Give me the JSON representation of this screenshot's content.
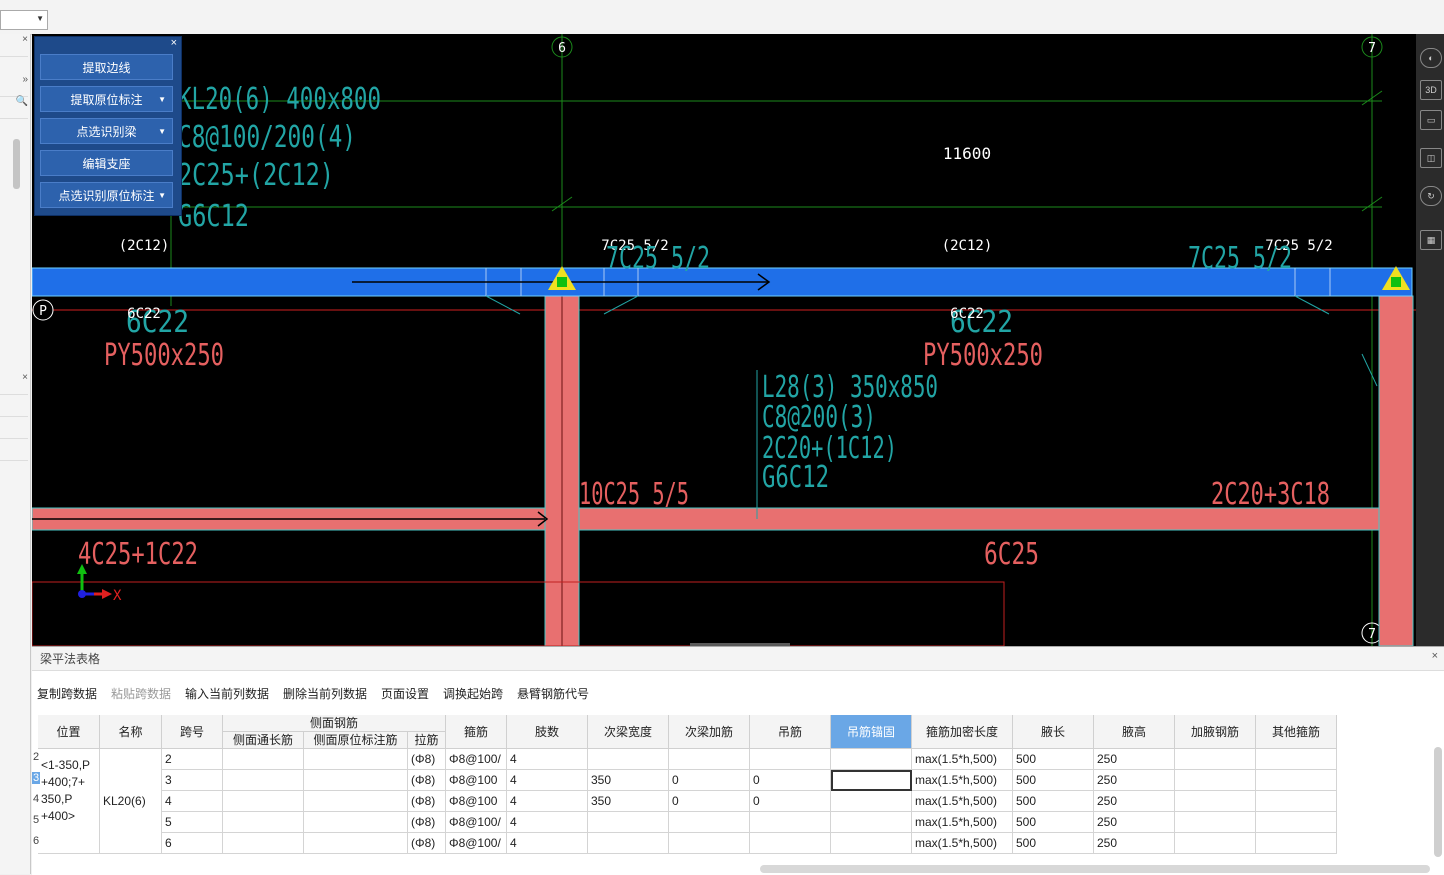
{
  "canvas": {
    "axis_labels": [
      "6",
      "7",
      "P",
      "6",
      "7",
      "P"
    ],
    "beam_kl20": {
      "name": "KL20(6) 400x800",
      "stirrup": "C8@100/200(4)",
      "top_bars": "2C25+(2C12)",
      "side_bars": "G6C12"
    },
    "dimension": "11600",
    "support_labels": {
      "left_2c12": "(2C12)",
      "mid_2c12": "(2C12)",
      "top_7c25_a": "7C25 5/2",
      "top_7c25_b": "7C25 5/2",
      "cyan_7c25_a": "7C25 5/2",
      "cyan_7c25_b": "7C25 5/2"
    },
    "bottom_labels": {
      "white_6c22_a": "6C22",
      "white_6c22_b": "6C22",
      "cyan_6c22_a": "6C22",
      "cyan_6c22_b": "6C22",
      "py_a": "PY500x250",
      "py_b": "PY500x250"
    },
    "beam_l28": {
      "name": "L28(3) 350x850",
      "stirrup": "C8@200(3)",
      "top_bars": "2C20+(1C12)",
      "side_bars": "G6C12"
    },
    "red_labels": {
      "bot_10c25": "10C25 5/5",
      "bot_2c20": "2C20+3C18",
      "bot_6c25": "6C25",
      "bot_4c25": "4C25+1C22"
    },
    "ucs": {
      "x": "X"
    },
    "colors": {
      "beam_blue": "#1f6fe8",
      "column_red": "#e87070",
      "text_cyan": "#22a5a5",
      "text_red": "#e56060",
      "grid_green": "#1b8a1b",
      "support_yellow": "#f0e020"
    }
  },
  "tool_panel": {
    "buttons": [
      "提取边线",
      "提取原位标注",
      "点选识别梁",
      "编辑支座",
      "点选识别原位标注"
    ],
    "close": "×"
  },
  "bottom_panel": {
    "title": "梁平法表格",
    "close": "×",
    "toolbar": [
      "复制跨数据",
      "粘贴跨数据",
      "输入当前列数据",
      "删除当前列数据",
      "页面设置",
      "调换起始跨",
      "悬臂钢筋代号"
    ],
    "headers": {
      "position": "位置",
      "name": "名称",
      "span": "跨号",
      "side_group": "侧面钢筋",
      "side_through": "侧面通长筋",
      "side_original": "侧面原位标注筋",
      "tie": "拉筋",
      "stirrup": "箍筋",
      "legs": "肢数",
      "sec_width": "次梁宽度",
      "sec_add": "次梁加筋",
      "hanger": "吊筋",
      "hanger_anchor": "吊筋锚固",
      "stirrup_dense": "箍筋加密长度",
      "haunch_len": "腋长",
      "haunch_h": "腋高",
      "haunch_bar": "加腋钢筋",
      "other_stirrup": "其他箍筋"
    },
    "position_text": [
      "<1-350,P",
      "+400;7+",
      "350,P",
      "+400>"
    ],
    "name_value": "KL20(6)",
    "row_numbers": [
      "2",
      "3",
      "4",
      "5",
      "6"
    ],
    "rows": [
      {
        "span": "2",
        "tie": "(Φ8)",
        "stirrup": "Φ8@100/",
        "legs": "4",
        "sec_width": "",
        "sec_add": "",
        "hanger": "",
        "dense": "max(1.5*h,500)",
        "hlen": "500",
        "hh": "250"
      },
      {
        "span": "3",
        "tie": "(Φ8)",
        "stirrup": "Φ8@100",
        "legs": "4",
        "sec_width": "350",
        "sec_add": "0",
        "hanger": "0",
        "dense": "max(1.5*h,500)",
        "hlen": "500",
        "hh": "250"
      },
      {
        "span": "4",
        "tie": "(Φ8)",
        "stirrup": "Φ8@100",
        "legs": "4",
        "sec_width": "350",
        "sec_add": "0",
        "hanger": "0",
        "dense": "max(1.5*h,500)",
        "hlen": "500",
        "hh": "250"
      },
      {
        "span": "5",
        "tie": "(Φ8)",
        "stirrup": "Φ8@100/",
        "legs": "4",
        "sec_width": "",
        "sec_add": "",
        "hanger": "",
        "dense": "max(1.5*h,500)",
        "hlen": "500",
        "hh": "250"
      },
      {
        "span": "6",
        "tie": "(Φ8)",
        "stirrup": "Φ8@100/",
        "legs": "4",
        "sec_width": "",
        "sec_add": "",
        "hanger": "",
        "dense": "max(1.5*h,500)",
        "hlen": "500",
        "hh": "250"
      }
    ]
  }
}
